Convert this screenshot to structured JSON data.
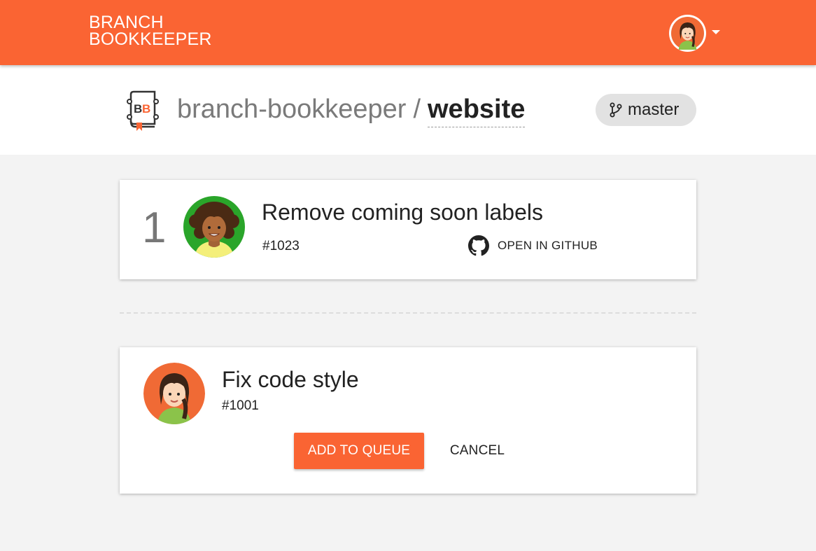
{
  "header": {
    "brand_line1": "BRANCH",
    "brand_line2": "BOOKKEEPER",
    "user_avatar_icon": "user-avatar-woman",
    "menu_icon": "caret-down-icon",
    "brand_color": "#fa6433"
  },
  "repo": {
    "logo_text": "BB",
    "owner": "branch-bookkeeper",
    "separator": "/",
    "name": "website",
    "branch_icon": "git-branch-icon",
    "branch": "master"
  },
  "queue": [
    {
      "position": "1",
      "title": "Remove coming soon labels",
      "number": "#1023",
      "link_label": "OPEN IN GITHUB",
      "link_icon": "github-icon"
    }
  ],
  "candidate": {
    "title": "Fix code style",
    "number": "#1001",
    "add_label": "ADD TO QUEUE",
    "cancel_label": "CANCEL"
  }
}
